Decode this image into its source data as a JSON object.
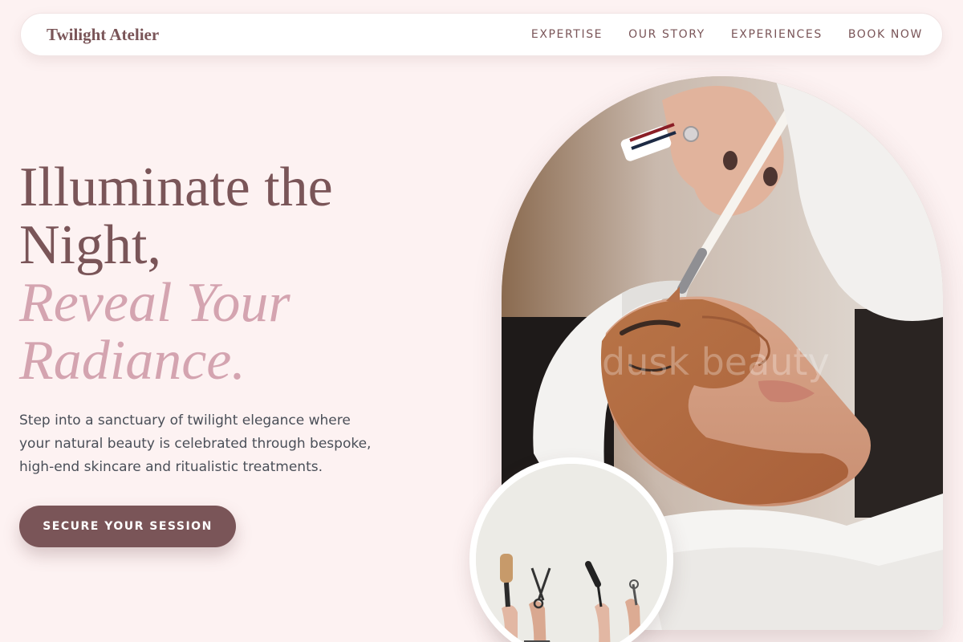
{
  "nav": {
    "brand": "Twilight Atelier",
    "links": [
      "EXPERTISE",
      "OUR STORY",
      "EXPERIENCES",
      "BOOK NOW"
    ]
  },
  "hero": {
    "headline_line1": "Illuminate the",
    "headline_line2": "Night,",
    "headline_accent1": "Reveal Your",
    "headline_accent2": "Radiance.",
    "description": "Step into a sanctuary of twilight elegance where your natural beauty is celebrated through bespoke, high-end skincare and ritualistic treatments.",
    "cta_label": "SECURE YOUR SESSION"
  },
  "images": {
    "main_watermark": "dusk beauty"
  },
  "colors": {
    "background": "#fdf2f2",
    "brand": "#7a5558",
    "accent": "#d4a4b0",
    "body_text": "#4a4f58"
  }
}
